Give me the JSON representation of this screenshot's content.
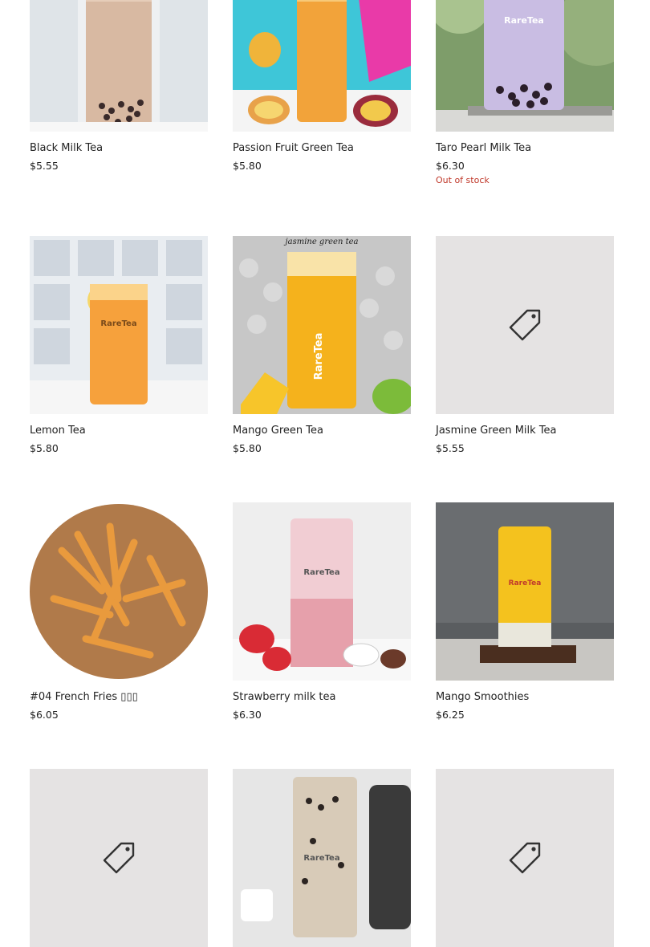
{
  "products": [
    {
      "name": "Black Milk Tea",
      "price": "$5.55",
      "image": "black-milk-tea-photo"
    },
    {
      "name": "Passion Fruit Green Tea",
      "price": "$5.80",
      "image": "passion-fruit-tea-photo"
    },
    {
      "name": "Taro Pearl Milk Tea",
      "price": "$6.30",
      "status": "Out of stock",
      "image": "taro-milk-tea-photo",
      "brand": "RareTea"
    },
    {
      "name": "Lemon Tea",
      "price": "$5.80",
      "image": "lemon-tea-photo",
      "brand": "RareTea"
    },
    {
      "name": "Mango Green Tea",
      "price": "$5.80",
      "image": "mango-green-tea-photo",
      "caption": "jasmine green tea",
      "brand": "RareTea"
    },
    {
      "name": "Jasmine Green Milk Tea",
      "price": "$5.55",
      "image": "tag-icon"
    },
    {
      "name": "#04 French Fries ▯▯▯",
      "price": "$6.05",
      "image": "french-fries-photo"
    },
    {
      "name": "Strawberry milk tea",
      "price": "$6.30",
      "image": "strawberry-milk-tea-photo",
      "brand": "RareTea"
    },
    {
      "name": "Mango Smoothies",
      "price": "$6.25",
      "image": "mango-smoothie-photo",
      "brand": "RareTea"
    },
    {
      "name": "",
      "price": "",
      "image": "tag-icon"
    },
    {
      "name": "",
      "price": "",
      "image": "oreo-milk-tea-photo",
      "brand": "RareTea"
    },
    {
      "name": "",
      "price": "",
      "image": "tag-icon"
    }
  ],
  "colors": {
    "out_of_stock": "#c0392b",
    "placeholder_bg": "#e5e3e3"
  }
}
